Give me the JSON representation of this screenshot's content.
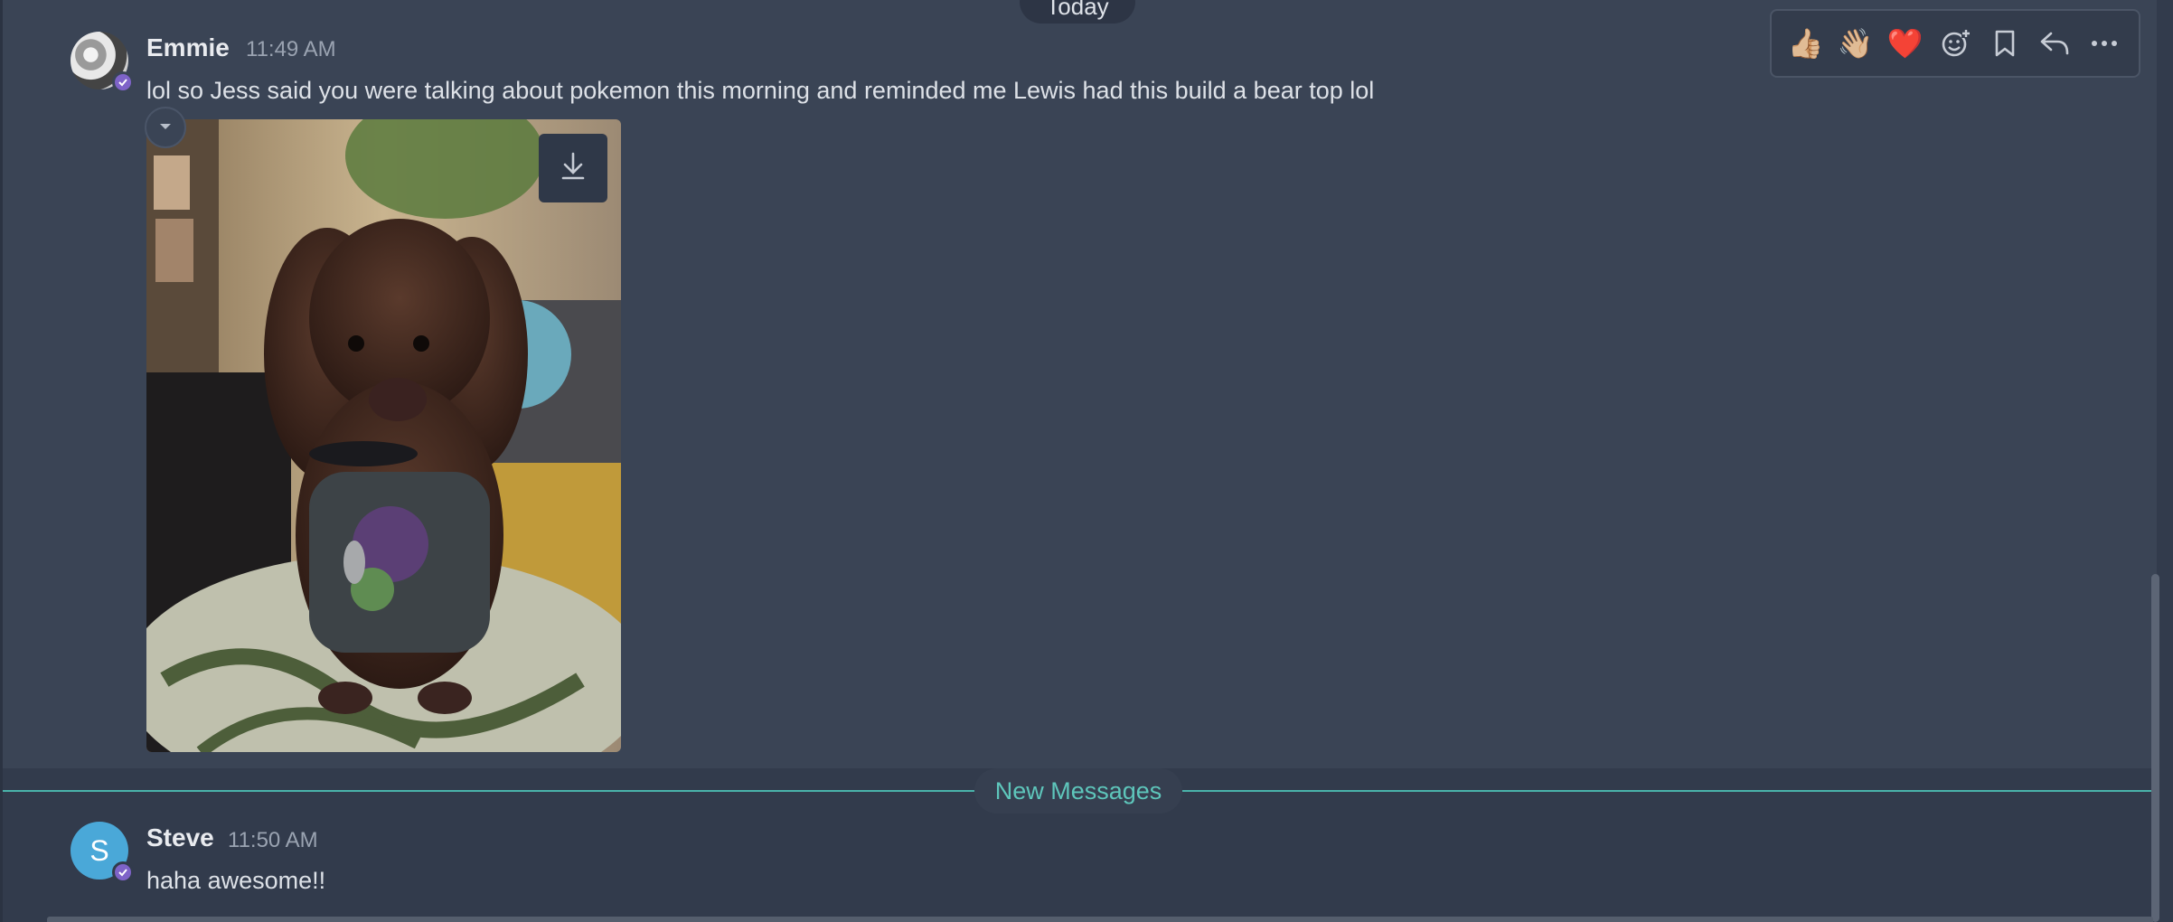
{
  "date_separator": "Today",
  "toolbar": {
    "reactions": [
      "👍🏼",
      "👋🏼",
      "❤️"
    ],
    "icons": [
      "add-reaction-icon",
      "bookmark-icon",
      "reply-icon",
      "more-icon"
    ]
  },
  "messages": [
    {
      "author": "Emmie",
      "time": "11:49 AM",
      "text": "lol so Jess said you were talking about pokemon this morning and reminded me Lewis had this build a bear top lol",
      "avatar_initial": "",
      "has_attachment": true
    },
    {
      "author": "Steve",
      "time": "11:50 AM",
      "text": "haha awesome!!",
      "avatar_initial": "S",
      "avatar_color": "#4aa8d8"
    }
  ],
  "new_messages_label": "New Messages",
  "colors": {
    "background": "#323b4c",
    "hover_background": "#3a4455",
    "accent_teal": "#5ec6bb",
    "verified_badge": "#7e63c8"
  }
}
